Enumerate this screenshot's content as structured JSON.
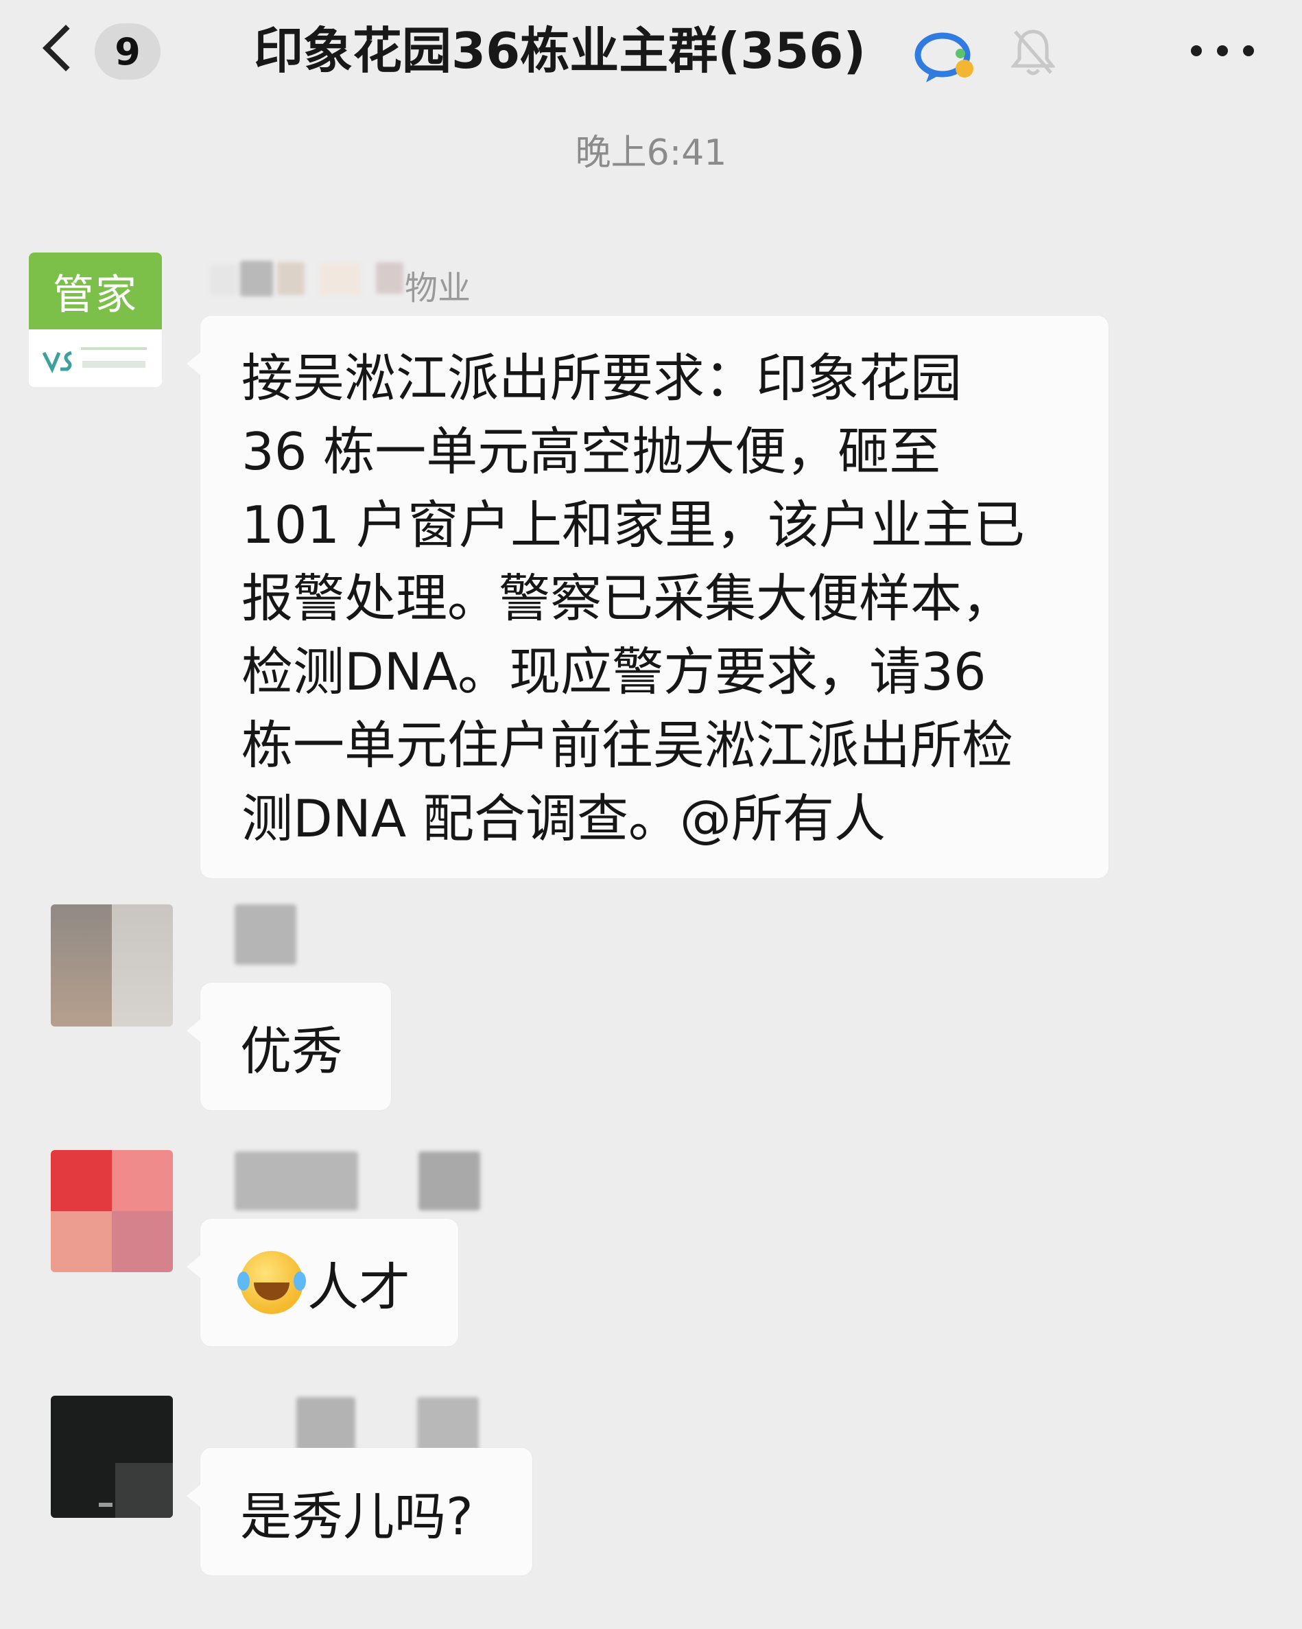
{
  "header": {
    "unread_count": "9",
    "group_title": "印象花园36栋业主群(356)",
    "icons": [
      "back-chevron-icon",
      "chat-bubble-icon",
      "mute-bell-icon",
      "more-icon"
    ]
  },
  "timestamp": "晚上6:41",
  "messages": [
    {
      "sender_visible_part": "物业",
      "avatar_label": "管家",
      "text": "接吴淞江派出所要求：印象花园\n36 栋一单元高空抛大便，砸至\n101 户窗户上和家里，该户业主已\n报警处理。警察已采集大便样本，\n检测DNA。现应警方要求，请36\n栋一单元住户前往吴淞江派出所检\n测DNA 配合调查。@所有人"
    },
    {
      "text": "优秀"
    },
    {
      "emoji": "laughing-crying-emoji",
      "text": "人才"
    },
    {
      "text": "是秀儿吗?"
    }
  ],
  "colors": {
    "background": "#ededed",
    "bubble": "#fbfbfb",
    "steward_avatar": "#7cc04a"
  }
}
